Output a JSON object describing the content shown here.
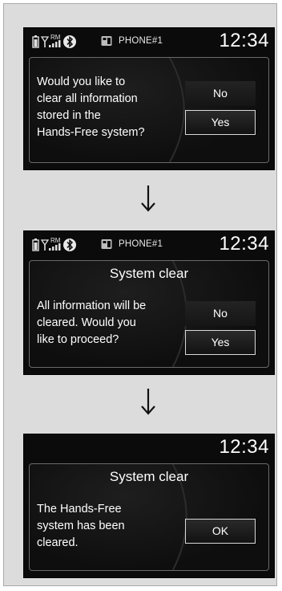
{
  "screens": [
    {
      "status": {
        "phone_name": "PHONE#1",
        "clock": "12:34",
        "roaming_label": "RM"
      },
      "dialog": {
        "message": "Would you like to\nclear all information\nstored in the\nHands-Free system?",
        "buttons": {
          "no": "No",
          "yes": "Yes"
        },
        "selected": "yes"
      }
    },
    {
      "status": {
        "phone_name": "PHONE#1",
        "clock": "12:34",
        "roaming_label": "RM"
      },
      "dialog": {
        "title": "System clear",
        "message": "All information will be\ncleared. Would you\nlike to proceed?",
        "buttons": {
          "no": "No",
          "yes": "Yes"
        },
        "selected": "yes"
      }
    },
    {
      "status": {
        "clock": "12:34"
      },
      "dialog": {
        "title": "System clear",
        "message": "The Hands-Free\nsystem has been\ncleared.",
        "buttons": {
          "ok": "OK"
        },
        "selected": "ok"
      }
    }
  ],
  "icons": {
    "battery": "battery-icon",
    "signal": "signal-strength-icon",
    "bluetooth": "bluetooth-icon",
    "phone": "phone-icon",
    "flow_arrow": "down-arrow-icon"
  },
  "colors": {
    "page_background": "#dcdcdc",
    "screen_background": "#0b0b0b",
    "text": "#ffffff",
    "dialog_border": "#6a6a6a",
    "selected_border": "#d8d8d8"
  }
}
